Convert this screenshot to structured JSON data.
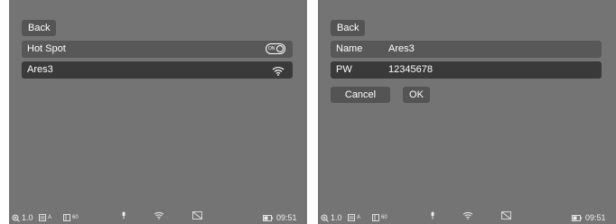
{
  "left_screen": {
    "back_label": "Back",
    "hotspot": {
      "label": "Hot Spot",
      "toggle_text": "ON"
    },
    "wifi": {
      "ssid": "Ares3"
    }
  },
  "right_screen": {
    "back_label": "Back",
    "name": {
      "label": "Name",
      "value": "Ares3"
    },
    "password": {
      "label": "PW",
      "value": "12345678"
    },
    "cancel_label": "Cancel",
    "ok_label": "OK"
  },
  "status_bar": {
    "zoom": "1.0",
    "mode": "A",
    "refresh": "60",
    "time": "09:51",
    "icons": [
      "zoom-icon",
      "image-mode-icon",
      "refresh-rate-icon",
      "microphone-icon",
      "wifi-icon",
      "no-signal-icon",
      "battery-icon"
    ]
  }
}
